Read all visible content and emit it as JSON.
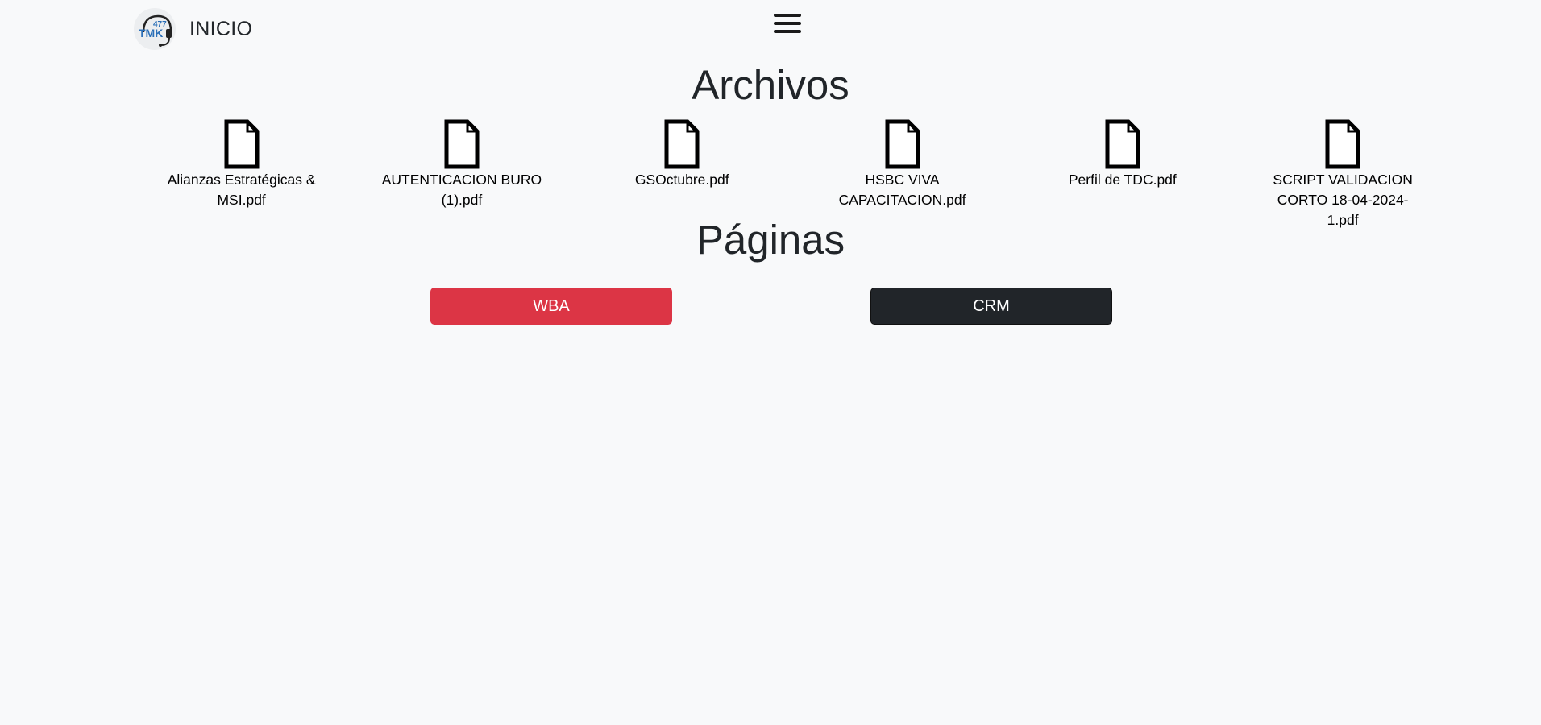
{
  "navbar": {
    "brand_text": "INICIO",
    "logo_text_top": "477",
    "logo_text_main": "TMK"
  },
  "archivos": {
    "title": "Archivos",
    "files": [
      {
        "name": "Alianzas Estratégicas & MSI.pdf"
      },
      {
        "name": "AUTENTICACION BURO (1).pdf"
      },
      {
        "name": "GSOctubre.pdf"
      },
      {
        "name": "HSBC VIVA CAPACITACION.pdf"
      },
      {
        "name": "Perfil de TDC.pdf"
      },
      {
        "name": "SCRIPT VALIDACION CORTO 18-04-2024-1.pdf"
      }
    ]
  },
  "paginas": {
    "title": "Páginas",
    "buttons": [
      {
        "label": "WBA",
        "color": "#dc3545"
      },
      {
        "label": "CRM",
        "color": "#212529"
      }
    ]
  },
  "icons": {
    "file": "file-icon",
    "menu": "hamburger-menu-icon",
    "logo": "headset-logo-icon"
  }
}
